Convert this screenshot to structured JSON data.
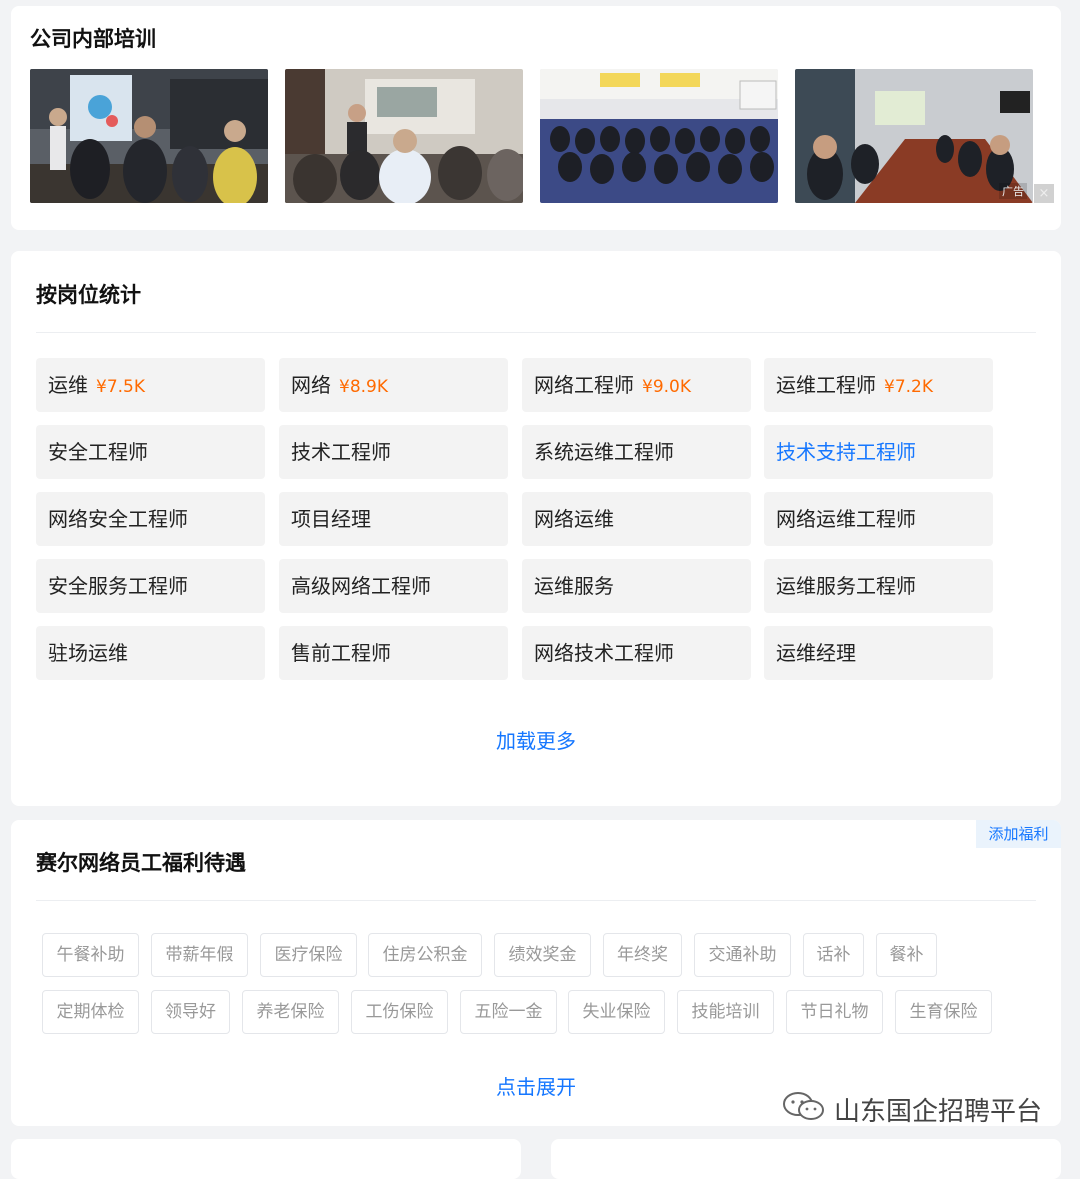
{
  "training": {
    "title": "公司内部培训",
    "ad_label": "广告",
    "ad_close": "×"
  },
  "positions": {
    "title": "按岗位统计",
    "items": [
      {
        "name": "运维",
        "salary": "¥7.5K"
      },
      {
        "name": "网络",
        "salary": "¥8.9K"
      },
      {
        "name": "网络工程师",
        "salary": "¥9.0K"
      },
      {
        "name": "运维工程师",
        "salary": "¥7.2K"
      },
      {
        "name": "安全工程师",
        "salary": ""
      },
      {
        "name": "技术工程师",
        "salary": ""
      },
      {
        "name": "系统运维工程师",
        "salary": ""
      },
      {
        "name": "技术支持工程师",
        "salary": ""
      },
      {
        "name": "网络安全工程师",
        "salary": ""
      },
      {
        "name": "项目经理",
        "salary": ""
      },
      {
        "name": "网络运维",
        "salary": ""
      },
      {
        "name": "网络运维工程师",
        "salary": ""
      },
      {
        "name": "安全服务工程师",
        "salary": ""
      },
      {
        "name": "高级网络工程师",
        "salary": ""
      },
      {
        "name": "运维服务",
        "salary": ""
      },
      {
        "name": "运维服务工程师",
        "salary": ""
      },
      {
        "name": "驻场运维",
        "salary": ""
      },
      {
        "name": "售前工程师",
        "salary": ""
      },
      {
        "name": "网络技术工程师",
        "salary": ""
      },
      {
        "name": "运维经理",
        "salary": ""
      }
    ],
    "load_more": "加载更多"
  },
  "welfare": {
    "title": "赛尔网络员工福利待遇",
    "add_label": "添加福利",
    "row1": [
      "午餐补助",
      "带薪年假",
      "医疗保险",
      "住房公积金",
      "绩效奖金",
      "年终奖",
      "交通补助",
      "话补",
      "餐补"
    ],
    "row2": [
      "定期体检",
      "领导好",
      "养老保险",
      "工伤保险",
      "五险一金",
      "失业保险",
      "技能培训",
      "节日礼物",
      "生育保险"
    ],
    "expand": "点击展开"
  },
  "watermark": {
    "text": "山东国企招聘平台"
  },
  "colors": {
    "accent": "#1677ff",
    "salary": "#ff6a00",
    "tag_text": "#999999"
  }
}
